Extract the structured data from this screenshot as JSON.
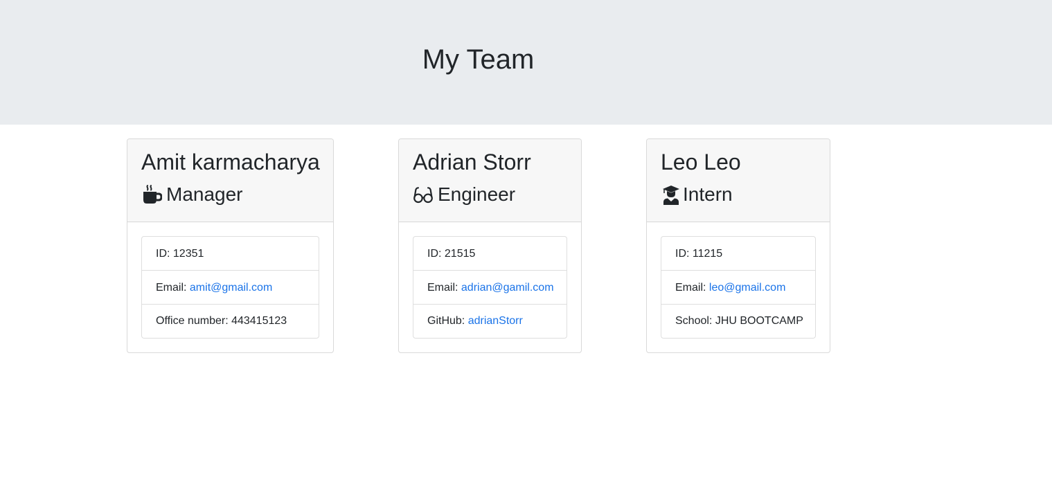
{
  "header": {
    "title": "My Team"
  },
  "colors": {
    "jumbotron": "#e9ecef",
    "link": "#1a73e8",
    "card_header": "#f7f7f7"
  },
  "cards": [
    {
      "name": "Amit karmacharya",
      "role": "Manager",
      "icon": "mug-icon",
      "id_text": "ID: 12351",
      "email_prefix": "Email: ",
      "email": "amit@gmail.com",
      "extra_prefix": "Office number: 443415123",
      "extra_link": ""
    },
    {
      "name": "Adrian Storr",
      "role": "Engineer",
      "icon": "glasses-icon",
      "id_text": "ID: 21515",
      "email_prefix": "Email: ",
      "email": "adrian@gamil.com",
      "extra_prefix": "GitHub: ",
      "extra_link": "adrianStorr"
    },
    {
      "name": "Leo Leo",
      "role": "Intern",
      "icon": "graduate-icon",
      "id_text": "ID: 11215",
      "email_prefix": "Email: ",
      "email": "leo@gmail.com",
      "extra_prefix": "School: JHU BOOTCAMP",
      "extra_link": ""
    }
  ]
}
